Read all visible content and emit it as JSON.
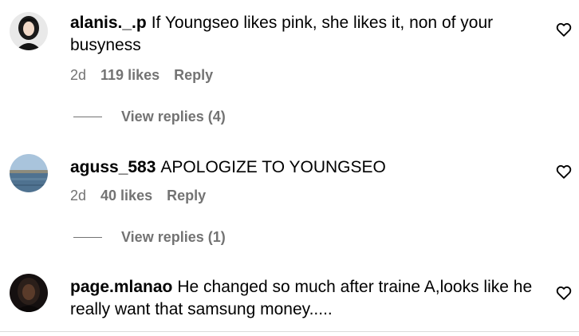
{
  "comments": [
    {
      "username": "alanis._.p",
      "text": "If Youngseo likes pink, she likes it, non of your busyness",
      "time": "2d",
      "likes": "119 likes",
      "reply": "Reply",
      "view_replies": "View replies (4)"
    },
    {
      "username": "aguss_583",
      "text": "APOLOGIZE TO YOUNGSEO",
      "time": "2d",
      "likes": "40 likes",
      "reply": "Reply",
      "view_replies": "View replies (1)"
    },
    {
      "username": "page.mlanao",
      "text": "He changed so much after traine A,looks like he really want that samsung money....."
    }
  ],
  "colors": {
    "secondary_text": "#737373",
    "divider": "#dbdbdb"
  },
  "icons": {
    "like": "heart-outline-icon"
  }
}
